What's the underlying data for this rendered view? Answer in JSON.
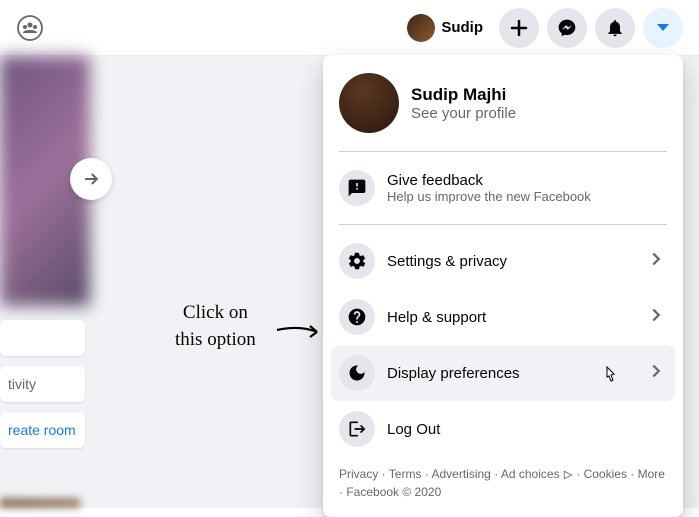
{
  "topbar": {
    "username": "Sudip"
  },
  "leftcards": {
    "activity": "tivity",
    "create_room": "reate room"
  },
  "annotation": {
    "line1": "Click on",
    "line2": "this option"
  },
  "dropdown": {
    "profile": {
      "name": "Sudip Majhi",
      "subtitle": "See your profile"
    },
    "feedback": {
      "title": "Give feedback",
      "subtitle": "Help us improve the new Facebook"
    },
    "settings": {
      "title": "Settings & privacy"
    },
    "help": {
      "title": "Help & support"
    },
    "display": {
      "title": "Display preferences"
    },
    "logout": {
      "title": "Log Out"
    },
    "footer": {
      "privacy": "Privacy",
      "terms": "Terms",
      "advertising": "Advertising",
      "adchoices": "Ad choices",
      "cookies": "Cookies",
      "more": "More",
      "copyright": "Facebook © 2020"
    }
  }
}
